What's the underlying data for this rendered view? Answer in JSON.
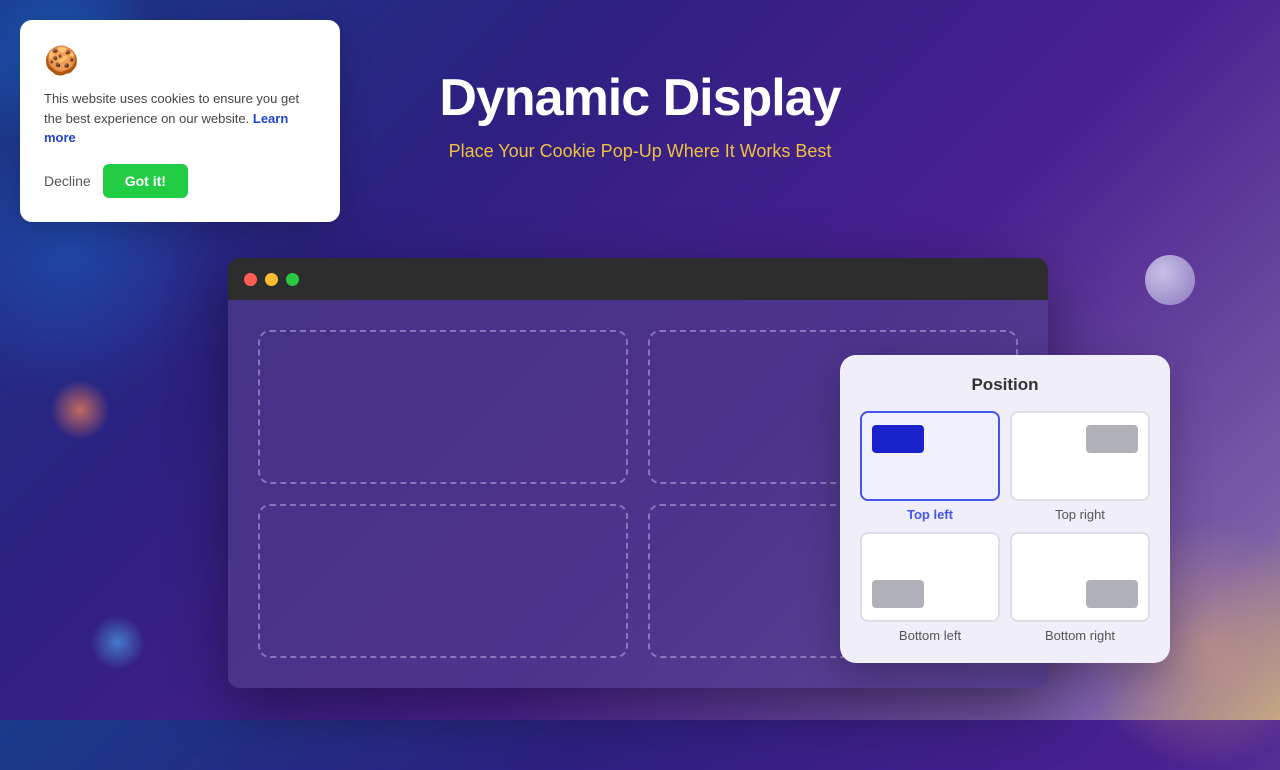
{
  "page": {
    "title": "Dynamic Display",
    "subtitle": "Place Your Cookie Pop-Up Where It Works Best"
  },
  "browser": {
    "traffic_dots": [
      "red",
      "yellow",
      "green"
    ]
  },
  "cookie_popup": {
    "icon": "🍪",
    "text": "This website uses cookies to ensure you get the best experience on our website.",
    "learn_more": "Learn more",
    "decline_label": "Decline",
    "gotit_label": "Got it!"
  },
  "position_panel": {
    "title": "Position",
    "options": [
      {
        "id": "top-left",
        "label": "Top left",
        "active": true
      },
      {
        "id": "top-right",
        "label": "Top right",
        "active": false
      },
      {
        "id": "bottom-left",
        "label": "Bottom left",
        "active": false
      },
      {
        "id": "bottom-right",
        "label": "Bottom right",
        "active": false
      }
    ]
  },
  "colors": {
    "accent": "#4455ee",
    "green": "#22cc44",
    "background_start": "#1a3a8a",
    "background_end": "#c4a882"
  }
}
